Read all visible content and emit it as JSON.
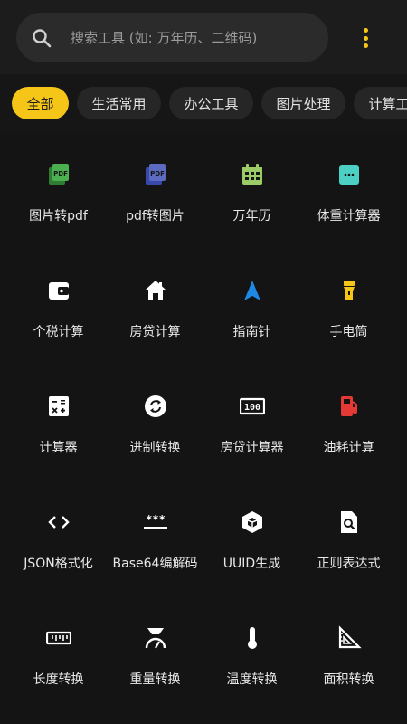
{
  "search": {
    "placeholder": "搜索工具 (如: 万年历、二维码)"
  },
  "categories": [
    {
      "label": "全部",
      "active": true
    },
    {
      "label": "生活常用",
      "active": false
    },
    {
      "label": "办公工具",
      "active": false
    },
    {
      "label": "图片处理",
      "active": false
    },
    {
      "label": "计算工具",
      "active": false
    }
  ],
  "tools": [
    {
      "label": "图片转pdf",
      "icon": "image-pdf-icon",
      "color": "#4caf50"
    },
    {
      "label": "pdf转图片",
      "icon": "pdf-image-icon",
      "color": "#5c6bc0"
    },
    {
      "label": "万年历",
      "icon": "calendar-icon",
      "color": "#9ccc65"
    },
    {
      "label": "体重计算器",
      "icon": "scale-icon",
      "color": "#4dd0c4"
    },
    {
      "label": "个税计算",
      "icon": "wallet-icon",
      "color": "#ffffff"
    },
    {
      "label": "房贷计算",
      "icon": "house-icon",
      "color": "#ffffff"
    },
    {
      "label": "指南针",
      "icon": "compass-arrow-icon",
      "color": "#1e88e5"
    },
    {
      "label": "手电筒",
      "icon": "flashlight-icon",
      "color": "#f5c518"
    },
    {
      "label": "计算器",
      "icon": "calculator-icon",
      "color": "#ffffff"
    },
    {
      "label": "进制转换",
      "icon": "convert-cycle-icon",
      "color": "#ffffff"
    },
    {
      "label": "房贷计算器",
      "icon": "counter-icon",
      "color": "#ffffff"
    },
    {
      "label": "油耗计算",
      "icon": "fuel-pump-icon",
      "color": "#e53935"
    },
    {
      "label": "JSON格式化",
      "icon": "code-brackets-icon",
      "color": "#ffffff"
    },
    {
      "label": "Base64编解码",
      "icon": "password-icon",
      "color": "#ffffff"
    },
    {
      "label": "UUID生成",
      "icon": "cube-icon",
      "color": "#ffffff"
    },
    {
      "label": "正则表达式",
      "icon": "file-search-icon",
      "color": "#ffffff"
    },
    {
      "label": "长度转换",
      "icon": "ruler-icon",
      "color": "#ffffff"
    },
    {
      "label": "重量转换",
      "icon": "weight-scale-icon",
      "color": "#ffffff"
    },
    {
      "label": "温度转换",
      "icon": "thermometer-icon",
      "color": "#ffffff"
    },
    {
      "label": "面积转换",
      "icon": "set-square-icon",
      "color": "#ffffff"
    }
  ]
}
